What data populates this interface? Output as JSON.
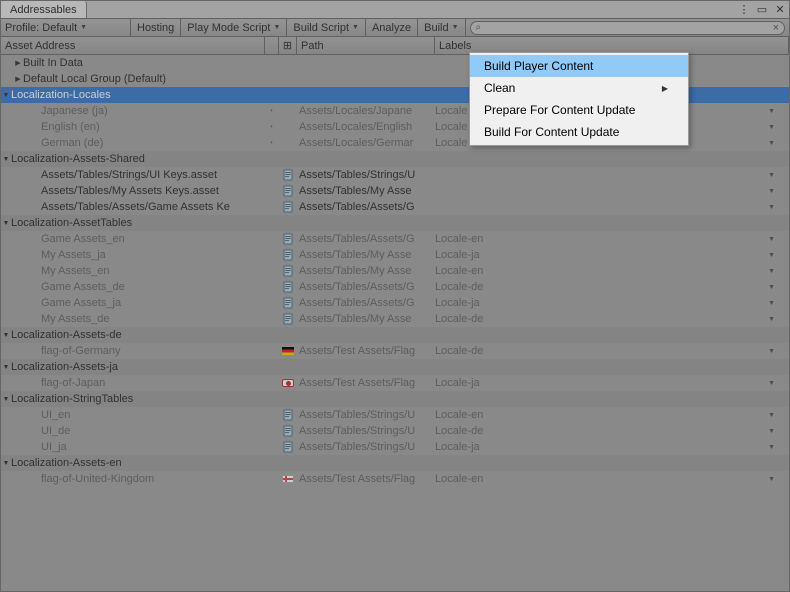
{
  "tab_title": "Addressables",
  "toolbar": {
    "profile_label": "Profile: Default",
    "hosting": "Hosting",
    "play_mode": "Play Mode Script",
    "build_script": "Build Script",
    "analyze": "Analyze",
    "build": "Build"
  },
  "columns": {
    "address": "Asset Address",
    "path": "Path",
    "labels": "Labels"
  },
  "dropdown": {
    "items": [
      {
        "label": "Build Player Content",
        "highlight": true
      },
      {
        "label": "Clean",
        "submenu": true
      },
      {
        "label": "Prepare For Content Update"
      },
      {
        "label": "Build For Content Update"
      }
    ]
  },
  "groups": [
    {
      "type": "top",
      "name": "Built In Data",
      "expanded": false
    },
    {
      "type": "top",
      "name": "Default Local Group (Default)",
      "expanded": false
    },
    {
      "type": "group",
      "name": "Localization-Locales",
      "selected": true,
      "items": [
        {
          "name": "Japanese (ja)",
          "lock": true,
          "path": "Assets/Locales/Japane",
          "label": "Locale",
          "disabled": true
        },
        {
          "name": "English (en)",
          "lock": true,
          "path": "Assets/Locales/English",
          "label": "Locale",
          "disabled": true
        },
        {
          "name": "German (de)",
          "lock": true,
          "path": "Assets/Locales/Germar",
          "label": "Locale",
          "disabled": true
        }
      ]
    },
    {
      "type": "group",
      "name": "Localization-Assets-Shared",
      "items": [
        {
          "name": "Assets/Tables/Strings/UI Keys.asset",
          "icon": "doc",
          "path": "Assets/Tables/Strings/U",
          "label": ""
        },
        {
          "name": "Assets/Tables/My Assets Keys.asset",
          "icon": "doc",
          "path": "Assets/Tables/My Asse",
          "label": ""
        },
        {
          "name": "Assets/Tables/Assets/Game Assets Ke",
          "icon": "doc",
          "path": "Assets/Tables/Assets/G",
          "label": ""
        }
      ]
    },
    {
      "type": "group",
      "name": "Localization-AssetTables",
      "items": [
        {
          "name": "Game Assets_en",
          "icon": "doc",
          "path": "Assets/Tables/Assets/G",
          "label": "Locale-en",
          "disabled": true
        },
        {
          "name": "My Assets_ja",
          "icon": "doc",
          "path": "Assets/Tables/My Asse",
          "label": "Locale-ja",
          "disabled": true
        },
        {
          "name": "My Assets_en",
          "icon": "doc",
          "path": "Assets/Tables/My Asse",
          "label": "Locale-en",
          "disabled": true
        },
        {
          "name": "Game Assets_de",
          "icon": "doc",
          "path": "Assets/Tables/Assets/G",
          "label": "Locale-de",
          "disabled": true
        },
        {
          "name": "Game Assets_ja",
          "icon": "doc",
          "path": "Assets/Tables/Assets/G",
          "label": "Locale-ja",
          "disabled": true
        },
        {
          "name": "My Assets_de",
          "icon": "doc",
          "path": "Assets/Tables/My Asse",
          "label": "Locale-de",
          "disabled": true
        }
      ]
    },
    {
      "type": "group",
      "name": "Localization-Assets-de",
      "items": [
        {
          "name": "flag-of-Germany",
          "icon": "de",
          "path": "Assets/Test Assets/Flag",
          "label": "Locale-de",
          "disabled": true
        }
      ]
    },
    {
      "type": "group",
      "name": "Localization-Assets-ja",
      "items": [
        {
          "name": "flag-of-Japan",
          "icon": "ja",
          "path": "Assets/Test Assets/Flag",
          "label": "Locale-ja",
          "disabled": true
        }
      ]
    },
    {
      "type": "group",
      "name": "Localization-StringTables",
      "items": [
        {
          "name": "UI_en",
          "icon": "doc",
          "path": "Assets/Tables/Strings/U",
          "label": "Locale-en",
          "disabled": true
        },
        {
          "name": "UI_de",
          "icon": "doc",
          "path": "Assets/Tables/Strings/U",
          "label": "Locale-de",
          "disabled": true
        },
        {
          "name": "UI_ja",
          "icon": "doc",
          "path": "Assets/Tables/Strings/U",
          "label": "Locale-ja",
          "disabled": true
        }
      ]
    },
    {
      "type": "group",
      "name": "Localization-Assets-en",
      "items": [
        {
          "name": "flag-of-United-Kingdom",
          "icon": "gb",
          "path": "Assets/Test Assets/Flag",
          "label": "Locale-en",
          "disabled": true
        }
      ]
    }
  ]
}
